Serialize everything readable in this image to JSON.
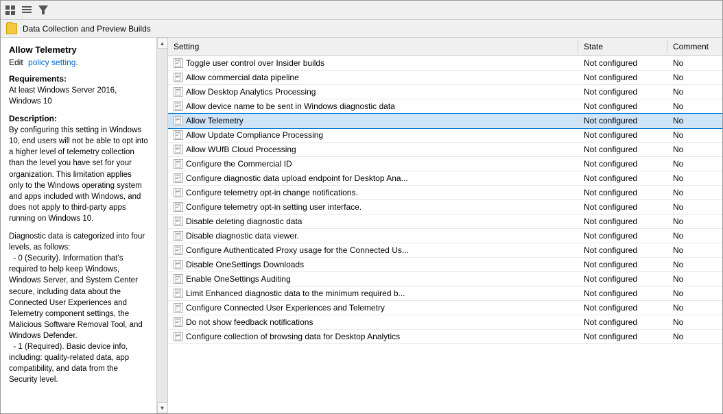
{
  "toolbar": {
    "icons": [
      "⊞",
      "☰",
      "▼"
    ]
  },
  "breadcrumb": {
    "folder_label": "Data Collection and Preview Builds"
  },
  "left_panel": {
    "title": "Allow Telemetry",
    "edit_label": "Edit",
    "policy_link": "policy setting.",
    "requirements_label": "Requirements:",
    "requirements_text": "At least Windows Server 2016, Windows 10",
    "description_label": "Description:",
    "description_text": "By configuring this setting in Windows 10, end users will not be able to opt into a higher level of telemetry collection than the level you have set for your organization.  This limitation applies only to the Windows operating system and apps included with Windows, and does not apply to third-party apps running on Windows 10.",
    "diagnostic_text": "Diagnostic data is categorized into four levels, as follows:\n  - 0 (Security). Information that's required to help keep Windows, Windows Server, and System Center secure, including data about the Connected User Experiences and Telemetry component settings, the Malicious Software Removal Tool, and Windows Defender.\n  - 1 (Required). Basic device info, including: quality-related data, app compatibility, and data from the Security level."
  },
  "table": {
    "headers": [
      "Setting",
      "State",
      "Comment"
    ],
    "rows": [
      {
        "name": "Toggle user control over Insider builds",
        "state": "Not configured",
        "comment": "No"
      },
      {
        "name": "Allow commercial data pipeline",
        "state": "Not configured",
        "comment": "No"
      },
      {
        "name": "Allow Desktop Analytics Processing",
        "state": "Not configured",
        "comment": "No"
      },
      {
        "name": "Allow device name to be sent in Windows diagnostic data",
        "state": "Not configured",
        "comment": "No"
      },
      {
        "name": "Allow Telemetry",
        "state": "Not configured",
        "comment": "No",
        "selected": true
      },
      {
        "name": "Allow Update Compliance Processing",
        "state": "Not configured",
        "comment": "No"
      },
      {
        "name": "Allow WUfB Cloud Processing",
        "state": "Not configured",
        "comment": "No"
      },
      {
        "name": "Configure the Commercial ID",
        "state": "Not configured",
        "comment": "No"
      },
      {
        "name": "Configure diagnostic data upload endpoint for Desktop Ana...",
        "state": "Not configured",
        "comment": "No"
      },
      {
        "name": "Configure telemetry opt-in change notifications.",
        "state": "Not configured",
        "comment": "No"
      },
      {
        "name": "Configure telemetry opt-in setting user interface.",
        "state": "Not configured",
        "comment": "No"
      },
      {
        "name": "Disable deleting diagnostic data",
        "state": "Not configured",
        "comment": "No"
      },
      {
        "name": "Disable diagnostic data viewer.",
        "state": "Not configured",
        "comment": "No"
      },
      {
        "name": "Configure Authenticated Proxy usage for the Connected Us...",
        "state": "Not configured",
        "comment": "No"
      },
      {
        "name": "Disable OneSettings Downloads",
        "state": "Not configured",
        "comment": "No"
      },
      {
        "name": "Enable OneSettings Auditing",
        "state": "Not configured",
        "comment": "No"
      },
      {
        "name": "Limit Enhanced diagnostic data to the minimum required b...",
        "state": "Not configured",
        "comment": "No"
      },
      {
        "name": "Configure Connected User Experiences and Telemetry",
        "state": "Not configured",
        "comment": "No"
      },
      {
        "name": "Do not show feedback notifications",
        "state": "Not configured",
        "comment": "No"
      },
      {
        "name": "Configure collection of browsing data for Desktop Analytics",
        "state": "Not configured",
        "comment": "No"
      }
    ]
  }
}
